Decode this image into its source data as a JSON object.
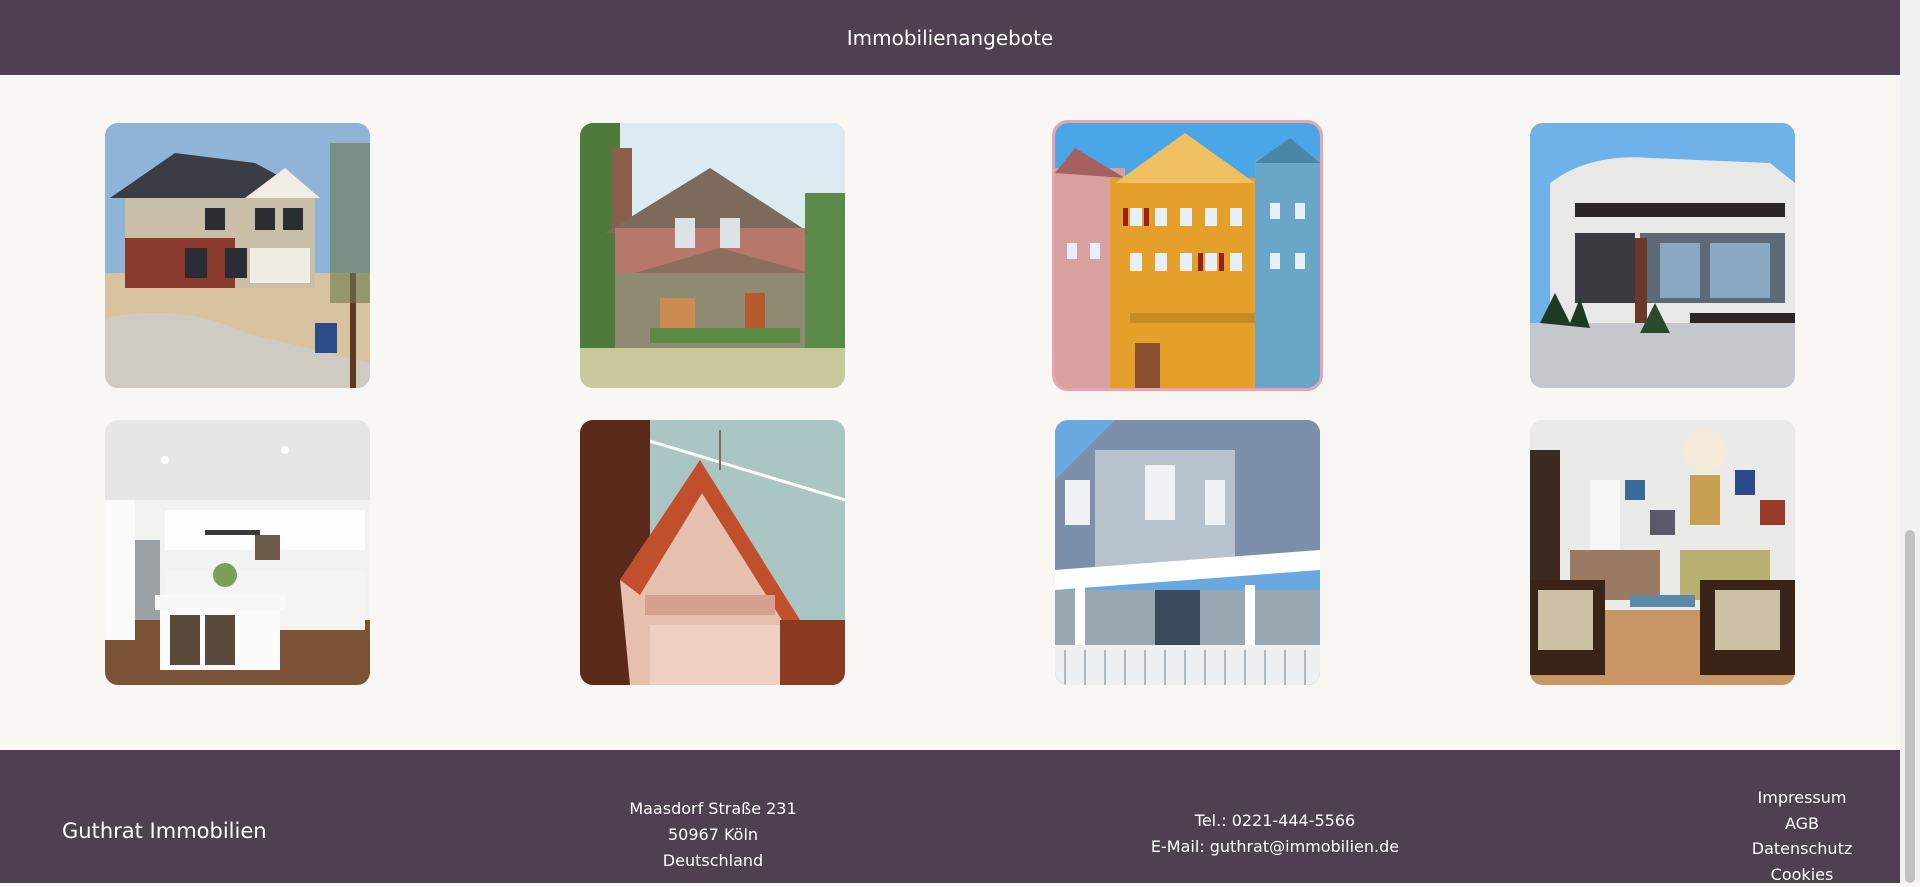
{
  "header": {
    "title": "Immobilienangebote"
  },
  "gallery": {
    "items": [
      {
        "alt": "Zweistöckiges Familienhaus mit Verkaufsschild"
      },
      {
        "alt": "Craftsman-Haus mit Veranda"
      },
      {
        "alt": "Bunte Fachwerkhäuser"
      },
      {
        "alt": "Moderne Villa mit Glasfront"
      },
      {
        "alt": "Helle Küche mit Kochinsel"
      },
      {
        "alt": "Viktorianischer Giebel"
      },
      {
        "alt": "Blaues Haus mit weißer Veranda"
      },
      {
        "alt": "Wohnzimmer mit Sesseln"
      }
    ]
  },
  "footer": {
    "brand": "Guthrat Immobilien",
    "address": {
      "street": "Maasdorf Straße 231",
      "city": "50967 Köln",
      "country": "Deutschland"
    },
    "contact": {
      "phone": "Tel.: 0221-444-5566",
      "email": "E-Mail: guthrat@immobilien.de"
    },
    "links": [
      "Impressum",
      "AGB",
      "Datenschutz",
      "Cookies"
    ]
  }
}
